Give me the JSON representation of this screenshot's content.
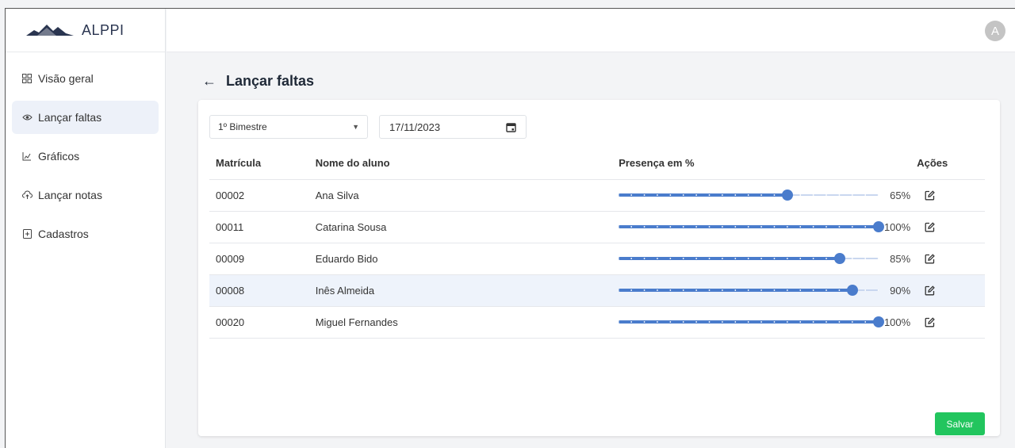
{
  "brand": {
    "name": "ALPPI"
  },
  "user": {
    "avatar_initial": "A"
  },
  "sidebar": {
    "items": [
      {
        "label": "Visão geral",
        "icon": "grid-icon",
        "active": false
      },
      {
        "label": "Lançar faltas",
        "icon": "eye-icon",
        "active": true
      },
      {
        "label": "Gráficos",
        "icon": "chart-icon",
        "active": false
      },
      {
        "label": "Lançar notas",
        "icon": "upload-icon",
        "active": false
      },
      {
        "label": "Cadastros",
        "icon": "add-document-icon",
        "active": false
      }
    ]
  },
  "page": {
    "title": "Lançar faltas"
  },
  "filters": {
    "period_value": "1º Bimestre",
    "date_value": "17/11/2023"
  },
  "table": {
    "headers": {
      "id": "Matrícula",
      "name": "Nome do aluno",
      "presence": "Presença em %",
      "actions": "Ações"
    },
    "rows": [
      {
        "id": "00002",
        "name": "Ana Silva",
        "presence": 65,
        "presence_label": "65%"
      },
      {
        "id": "00011",
        "name": "Catarina Sousa",
        "presence": 100,
        "presence_label": "100%"
      },
      {
        "id": "00009",
        "name": "Eduardo Bido",
        "presence": 85,
        "presence_label": "85%"
      },
      {
        "id": "00008",
        "name": "Inês Almeida",
        "presence": 90,
        "presence_label": "90%",
        "highlighted": true
      },
      {
        "id": "00020",
        "name": "Miguel Fernandes",
        "presence": 100,
        "presence_label": "100%"
      }
    ]
  },
  "actions": {
    "save_label": "Salvar"
  },
  "colors": {
    "accent": "#4a7ccc",
    "save": "#22c55e",
    "active_nav": "#edf1f9",
    "brand_text": "#2a3550"
  }
}
